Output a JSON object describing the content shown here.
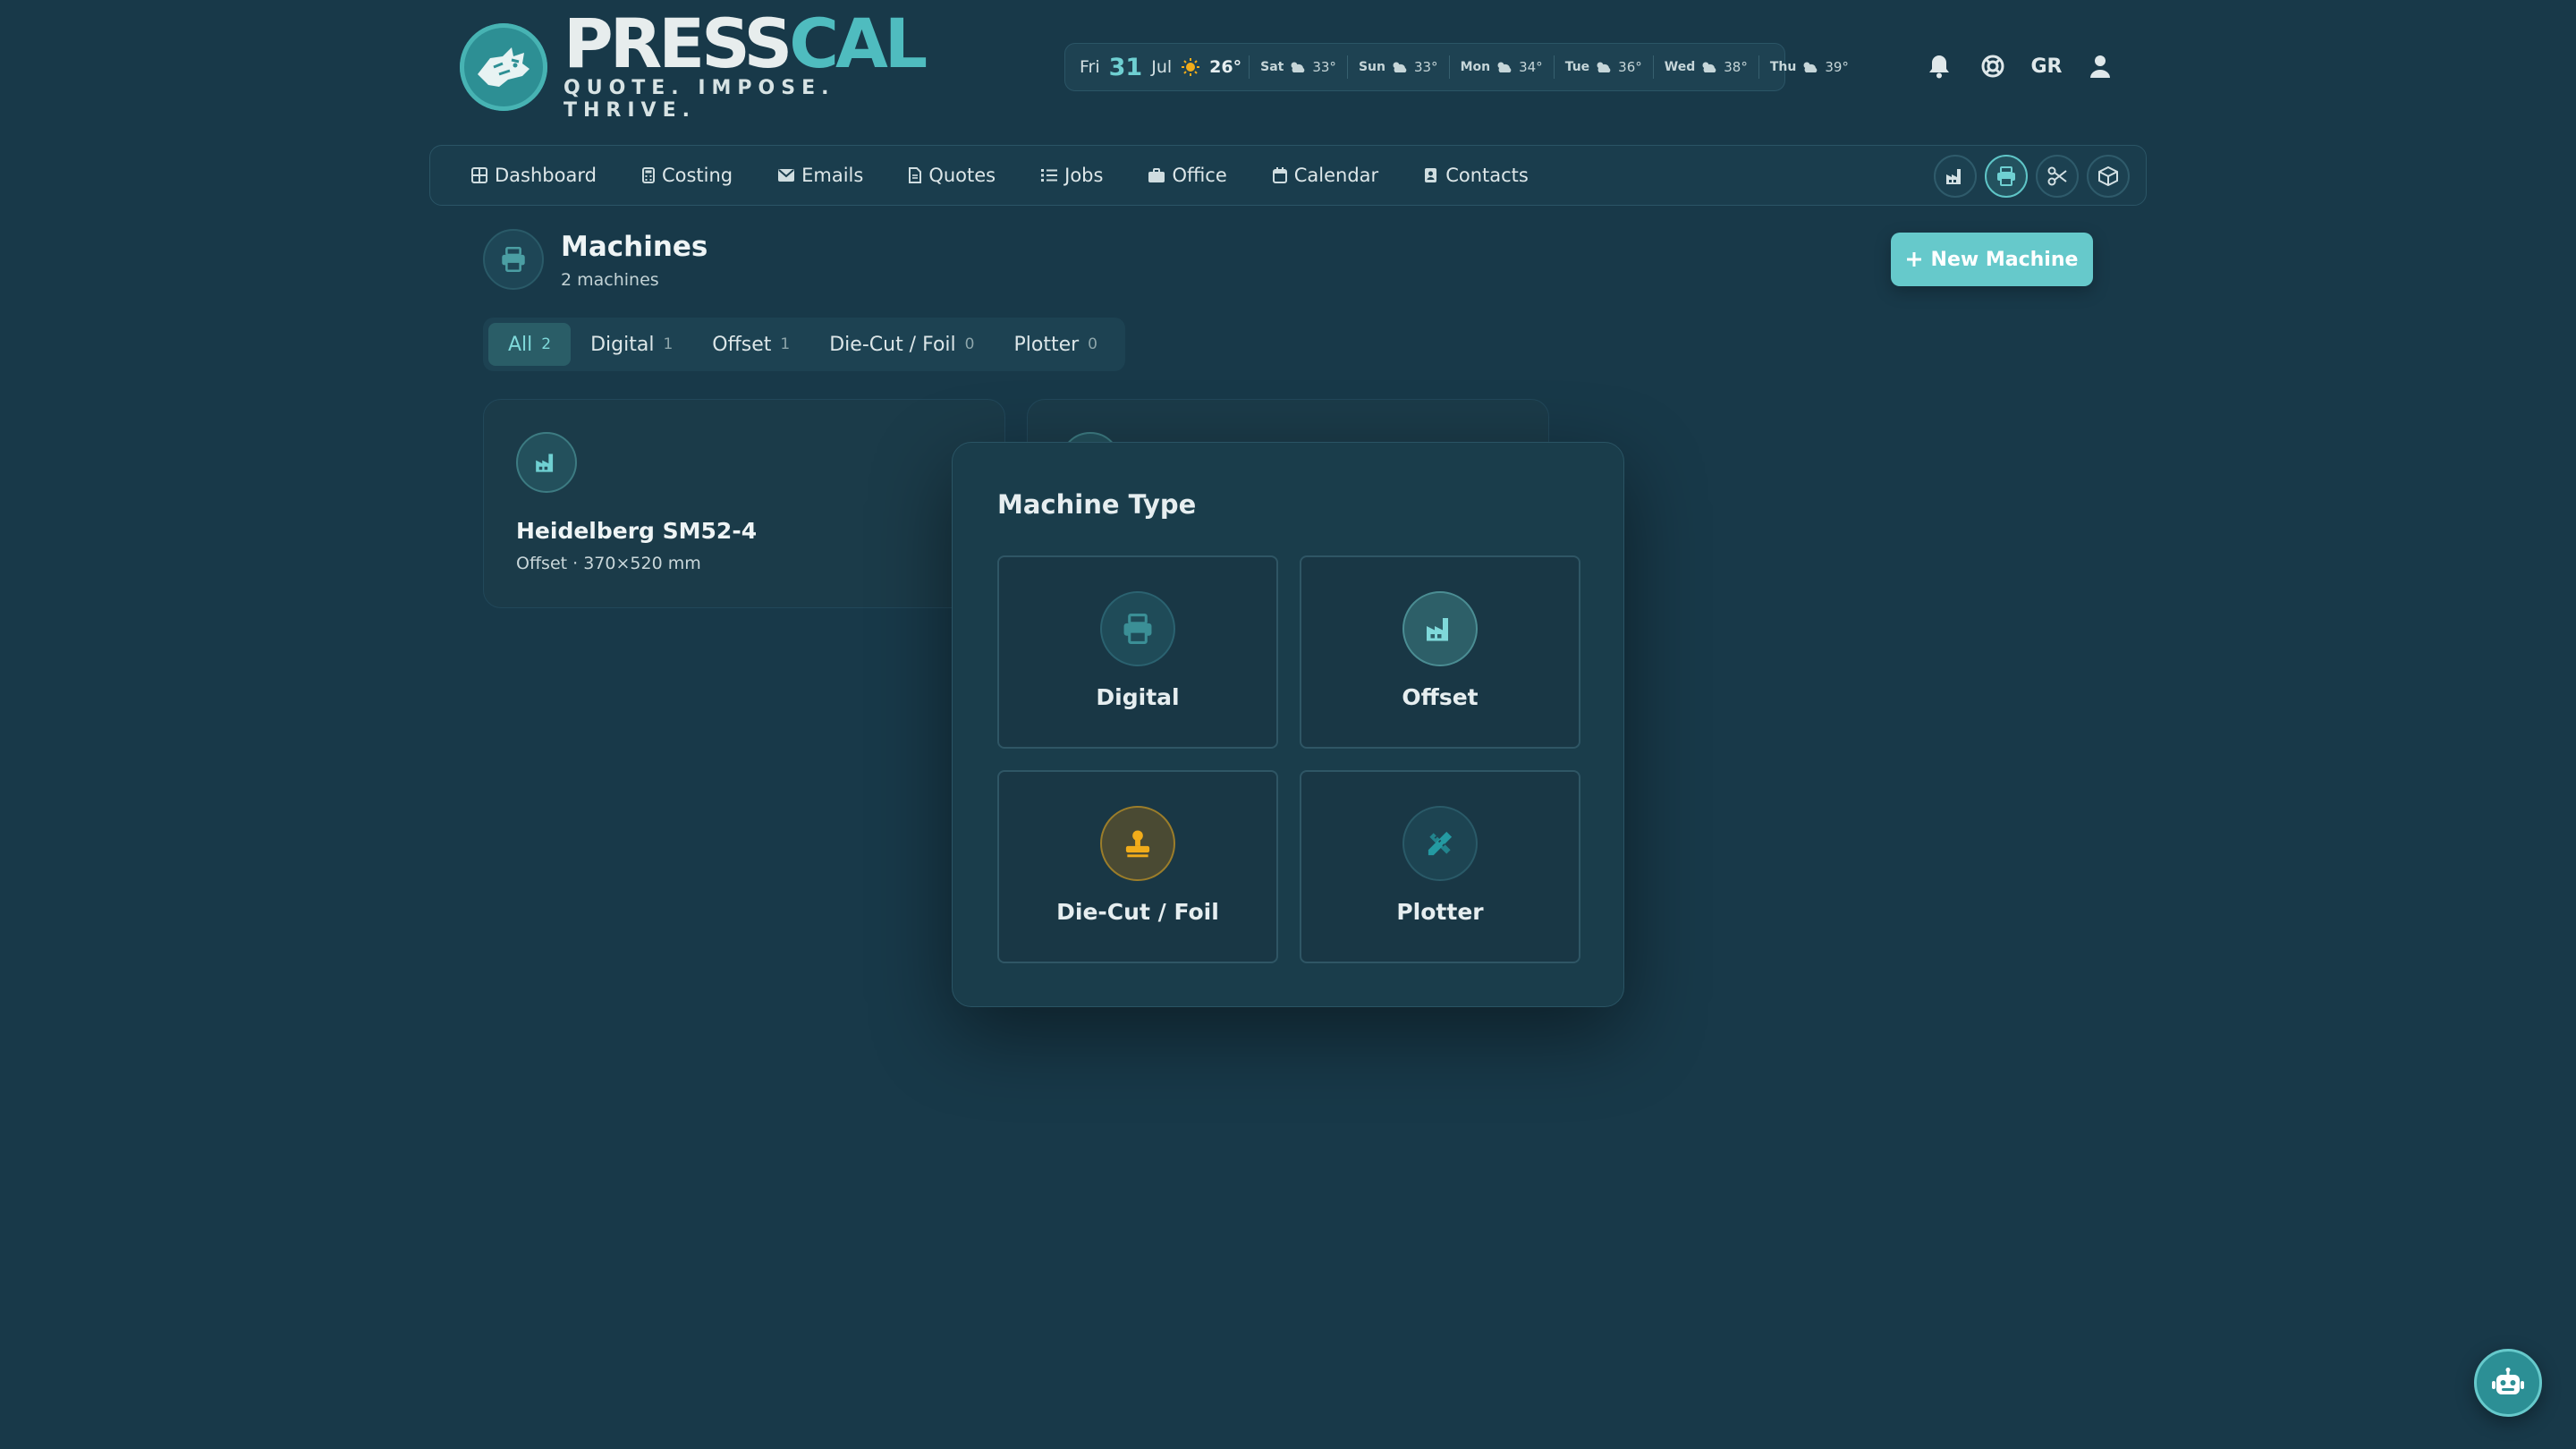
{
  "brand": {
    "name_part1": "PRESS",
    "name_part2": "CAL",
    "tagline": "QUOTE. IMPOSE. THRIVE."
  },
  "weather": {
    "today": {
      "day": "Fri",
      "date": "31",
      "month": "Jul",
      "temp": "26°",
      "icon": "sun-icon"
    },
    "forecast": [
      {
        "day": "Sat",
        "temp": "33°",
        "icon": "cloud-sun-icon"
      },
      {
        "day": "Sun",
        "temp": "33°",
        "icon": "cloud-sun-icon"
      },
      {
        "day": "Mon",
        "temp": "34°",
        "icon": "cloud-sun-icon"
      },
      {
        "day": "Tue",
        "temp": "36°",
        "icon": "cloud-sun-icon"
      },
      {
        "day": "Wed",
        "temp": "38°",
        "icon": "cloud-sun-icon"
      },
      {
        "day": "Thu",
        "temp": "39°",
        "icon": "cloud-sun-icon"
      }
    ]
  },
  "header": {
    "language": "GR"
  },
  "nav": {
    "items": [
      {
        "label": "Dashboard",
        "icon": "grid-icon"
      },
      {
        "label": "Costing",
        "icon": "calculator-icon"
      },
      {
        "label": "Emails",
        "icon": "envelope-icon"
      },
      {
        "label": "Quotes",
        "icon": "document-icon"
      },
      {
        "label": "Jobs",
        "icon": "list-icon"
      },
      {
        "label": "Office",
        "icon": "briefcase-icon"
      },
      {
        "label": "Calendar",
        "icon": "calendar-icon"
      },
      {
        "label": "Contacts",
        "icon": "address-book-icon"
      }
    ]
  },
  "page": {
    "title": "Machines",
    "subtitle": "2 machines",
    "new_button": "New Machine"
  },
  "filters": [
    {
      "label": "All",
      "count": "2",
      "active": true
    },
    {
      "label": "Digital",
      "count": "1"
    },
    {
      "label": "Offset",
      "count": "1"
    },
    {
      "label": "Die-Cut / Foil",
      "count": "0"
    },
    {
      "label": "Plotter",
      "count": "0"
    }
  ],
  "machines": [
    {
      "name": "Heidelberg SM52-4",
      "details": "Offset · 370×520 mm",
      "icon": "factory-icon"
    }
  ],
  "dialog": {
    "title": "Machine Type",
    "options": [
      {
        "label": "Digital",
        "icon": "printer-icon"
      },
      {
        "label": "Offset",
        "icon": "factory-icon"
      },
      {
        "label": "Die-Cut / Foil",
        "icon": "stamp-icon"
      },
      {
        "label": "Plotter",
        "icon": "pencil-ruler-icon"
      }
    ]
  },
  "colors": {
    "background": "#183949",
    "accent": "#66c9cb",
    "die_cut_icon": "#f1ac1a"
  }
}
